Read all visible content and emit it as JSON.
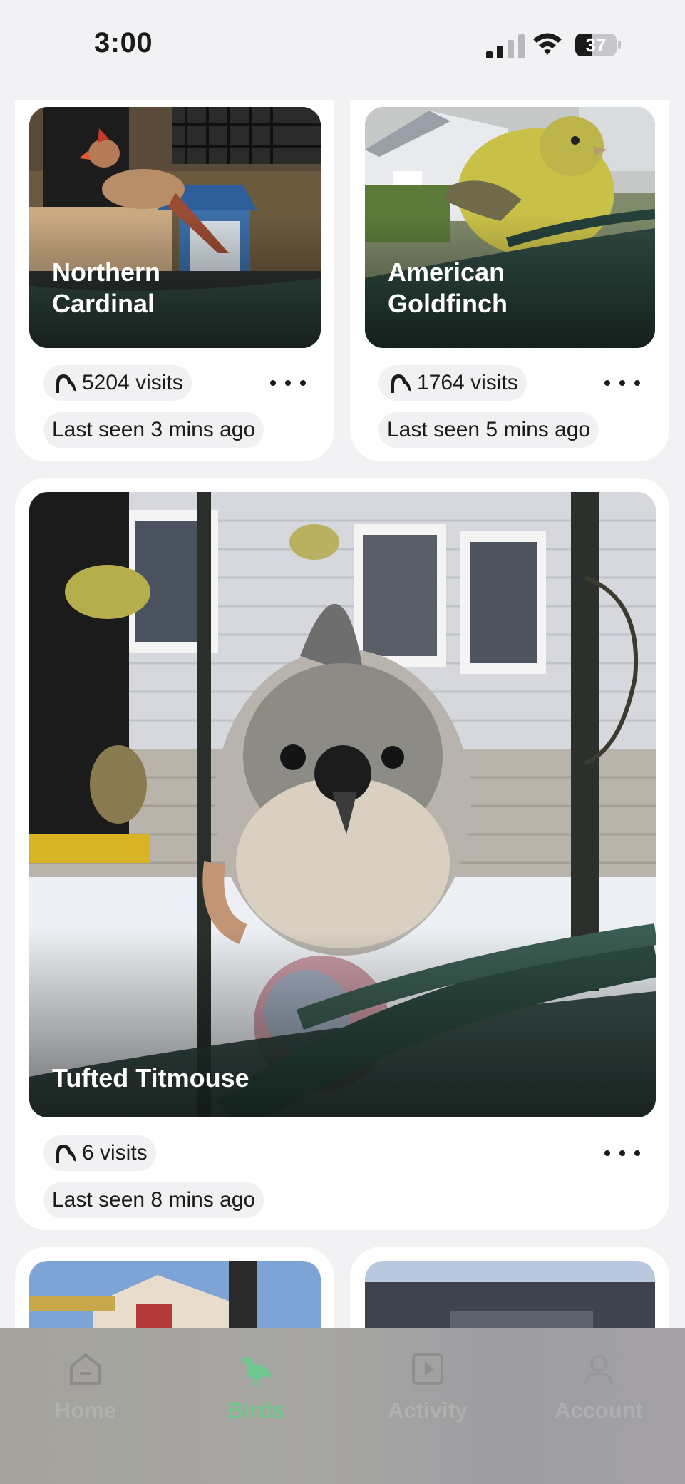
{
  "status_bar": {
    "time": "3:00",
    "battery": "37"
  },
  "birds": [
    {
      "name_line1": "Northern",
      "name_line2": "Cardinal",
      "visits": "5204 visits",
      "last_seen": "Last seen 3 mins ago"
    },
    {
      "name_line1": "American",
      "name_line2": "Goldfinch",
      "visits": "1764 visits",
      "last_seen": "Last seen 5 mins ago"
    },
    {
      "name_line1": "Tufted Titmouse",
      "visits": "6 visits",
      "last_seen": "Last seen 8 mins ago"
    }
  ],
  "tabs": [
    {
      "label": "Home",
      "icon": "home-icon",
      "active": false
    },
    {
      "label": "Birds",
      "icon": "bird-icon",
      "active": true
    },
    {
      "label": "Activity",
      "icon": "activity-icon",
      "active": false
    },
    {
      "label": "Account",
      "icon": "account-icon",
      "active": false
    }
  ],
  "colors": {
    "accent": "#6fc98f",
    "card": "#ffffff",
    "background": "#f2f2f5"
  }
}
